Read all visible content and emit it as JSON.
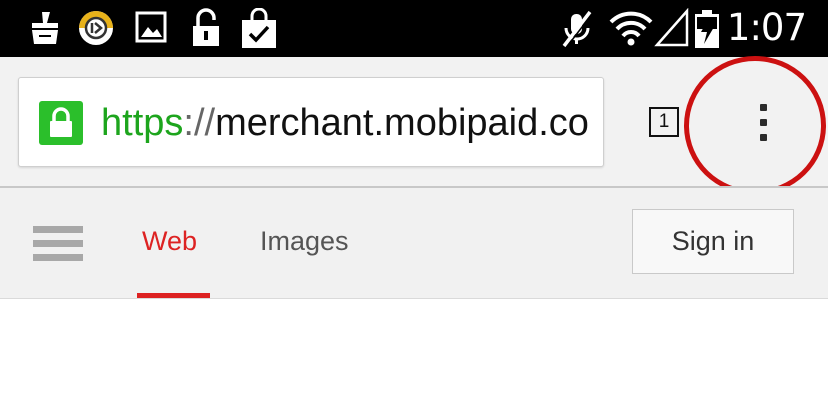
{
  "status_bar": {
    "time": "1:07",
    "left_icons": [
      "cleaner-icon",
      "app-badge-icon",
      "image-notification-icon",
      "unlock-icon",
      "shopping-bag-icon"
    ],
    "right_icons": [
      "muted-mic-icon",
      "wifi-icon",
      "signal-icon",
      "battery-charging-icon"
    ]
  },
  "browser": {
    "url": {
      "scheme": "https",
      "separator": "://",
      "host": "merchant.mobipaid.co"
    },
    "tab_count": "1",
    "secure_color": "#2bbf2b",
    "highlight_color": "#cc1111"
  },
  "search_header": {
    "tabs": [
      {
        "label": "Web",
        "active": true
      },
      {
        "label": "Images",
        "active": false
      }
    ],
    "sign_in_label": "Sign in",
    "accent_color": "#dd2222"
  }
}
